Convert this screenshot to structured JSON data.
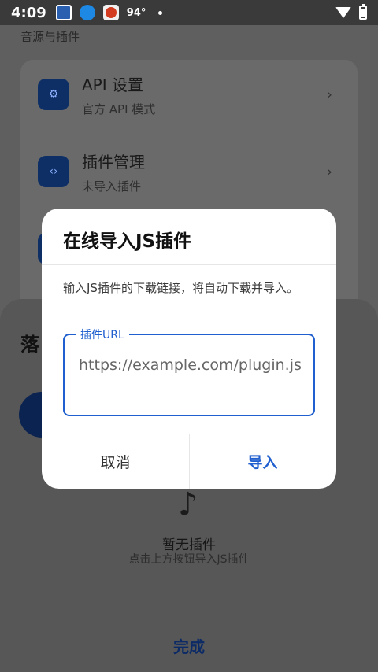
{
  "status_bar": {
    "time": "4:09",
    "temperature": "94°"
  },
  "background": {
    "section_label": "音源与插件",
    "settings": [
      {
        "title": "API 设置",
        "subtitle": "官方 API 模式",
        "icon": "gear-icon"
      },
      {
        "title": "插件管理",
        "subtitle": "未导入插件",
        "icon": "code-icon"
      }
    ],
    "chevron": "›"
  },
  "sheet": {
    "title": "落",
    "empty_title": "暂无插件",
    "empty_subtitle": "点击上方按钮导入JS插件",
    "done_label": "完成",
    "music_icon": "♪"
  },
  "dialog": {
    "title": "在线导入JS插件",
    "description": "输入JS插件的下载链接，将自动下载并导入。",
    "field_label": "插件URL",
    "field_value": "https://example.com/plugin.js",
    "cancel_label": "取消",
    "import_label": "导入",
    "accent_color": "#1f5fcf"
  }
}
